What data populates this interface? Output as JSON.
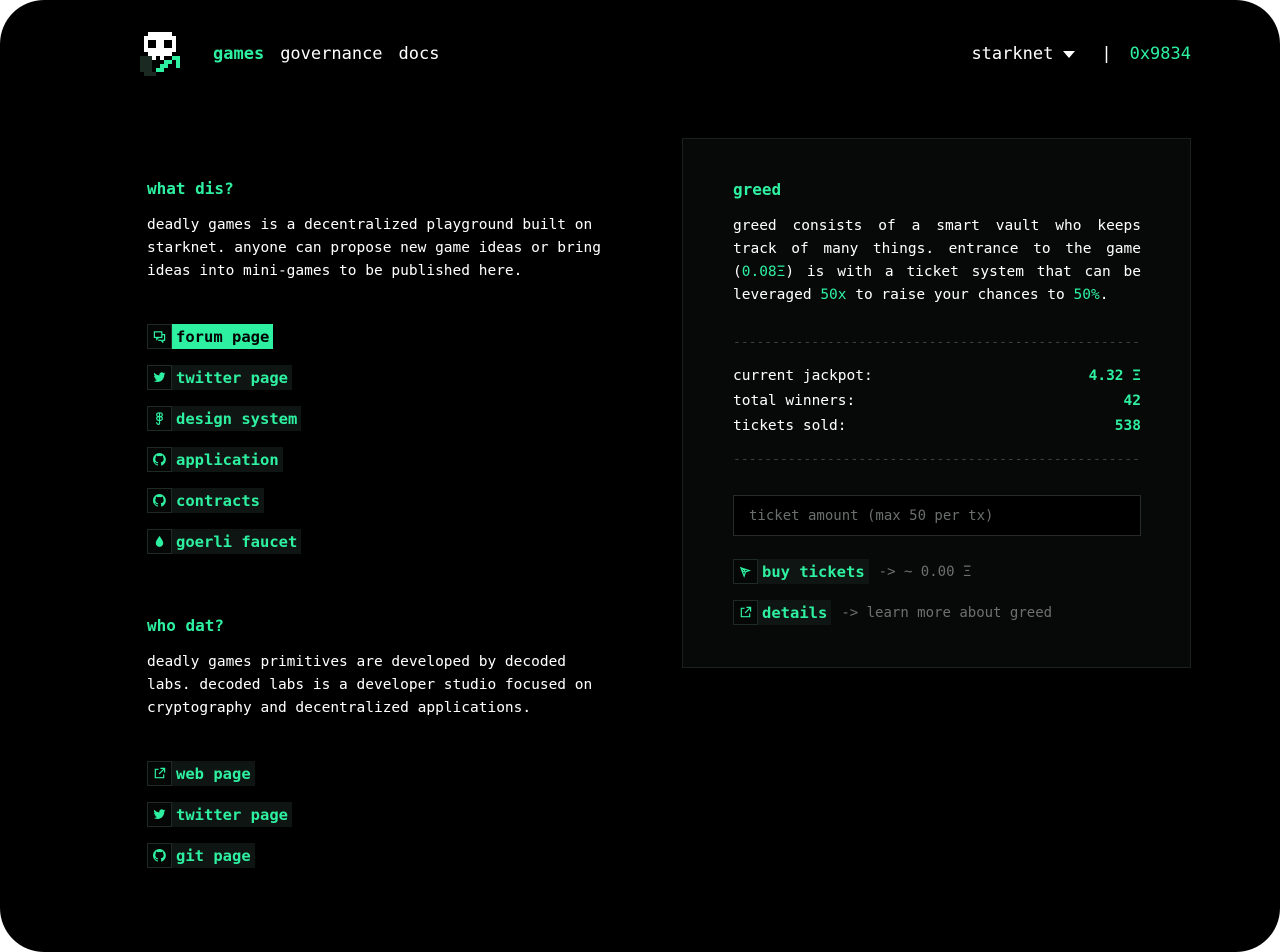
{
  "header": {
    "logo": "skull-logo",
    "nav": [
      {
        "label": "games",
        "active": true
      },
      {
        "label": "governance",
        "active": false
      },
      {
        "label": "docs",
        "active": false
      }
    ],
    "network": "starknet",
    "separator": "|",
    "address": "0x9834"
  },
  "about": {
    "title": "what dis?",
    "text": "deadly games is a decentralized playground built on starknet. anyone can propose new game ideas or bring ideas into mini-games to be published here.",
    "links": [
      {
        "label": "forum page",
        "icon": "chat-icon"
      },
      {
        "label": "twitter page",
        "icon": "twitter-icon"
      },
      {
        "label": "design system",
        "icon": "figma-icon"
      },
      {
        "label": "application",
        "icon": "github-icon"
      },
      {
        "label": "contracts",
        "icon": "github-icon"
      },
      {
        "label": "goerli faucet",
        "icon": "droplet-icon"
      }
    ]
  },
  "team": {
    "title": "who dat?",
    "text": "deadly games primitives are developed by decoded labs. decoded labs is a developer studio focused on cryptography and decentralized applications.",
    "links": [
      {
        "label": "web page",
        "icon": "external-link-icon"
      },
      {
        "label": "twitter page",
        "icon": "twitter-icon"
      },
      {
        "label": "git page",
        "icon": "github-icon"
      }
    ]
  },
  "game": {
    "title": "greed",
    "desc_1": "greed consists of a smart vault who keeps track of many things. entrance to the game (",
    "entry_fee": "0.08Ξ",
    "desc_2": ") is with a ticket system that can be leveraged ",
    "leverage": "50x",
    "desc_3": " to raise your chances to ",
    "chance": "50%",
    "desc_4": ".",
    "divider": "------------------------------------------------------------------",
    "stats": [
      {
        "label": "current jackpot:",
        "value": "4.32 Ξ"
      },
      {
        "label": "total winners:",
        "value": "42"
      },
      {
        "label": "tickets sold:",
        "value": "538"
      }
    ],
    "ticket_placeholder": "ticket amount (max 50 per tx)",
    "buy_label": "buy tickets",
    "buy_note": "-> ~ 0.00 Ξ",
    "details_label": "details",
    "details_note": "-> learn more about greed"
  },
  "colors": {
    "accent": "#2ef0a1",
    "background": "#000000",
    "panel": "#070808"
  }
}
